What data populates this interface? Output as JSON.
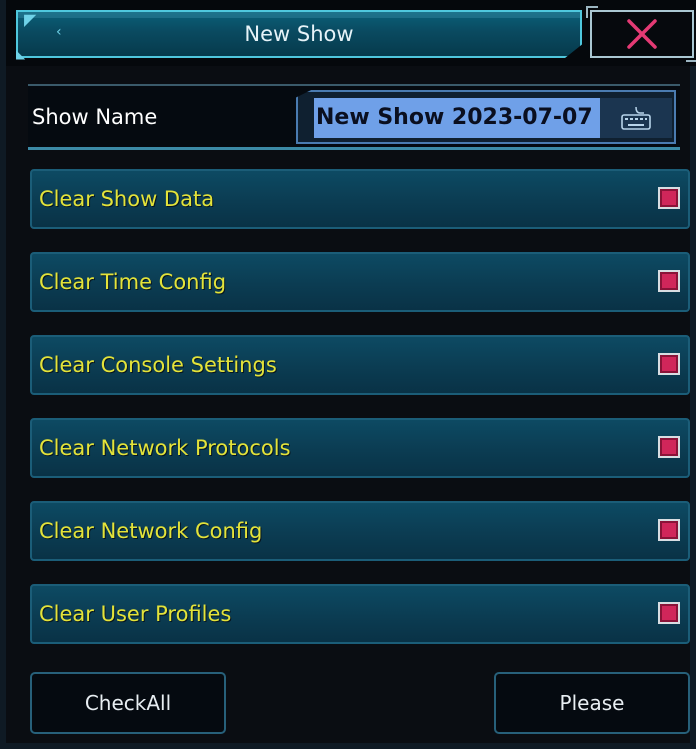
{
  "window": {
    "title": "New Show",
    "close_icon": "close-x-icon",
    "accent_color": "#4fc7dd",
    "close_color": "#e43a74"
  },
  "show_name": {
    "label": "Show Name",
    "value": "New Show 2023-07-07",
    "keyboard_icon": "keyboard-icon"
  },
  "options": [
    {
      "label": "Clear Show Data",
      "checked": true
    },
    {
      "label": "Clear Time Config",
      "checked": true
    },
    {
      "label": "Clear Console Settings",
      "checked": true
    },
    {
      "label": "Clear Network Protocols",
      "checked": true
    },
    {
      "label": "Clear Network Config",
      "checked": true
    },
    {
      "label": "Clear User Profiles",
      "checked": true
    }
  ],
  "buttons": {
    "check_all": "CheckAll",
    "confirm": "Please"
  }
}
